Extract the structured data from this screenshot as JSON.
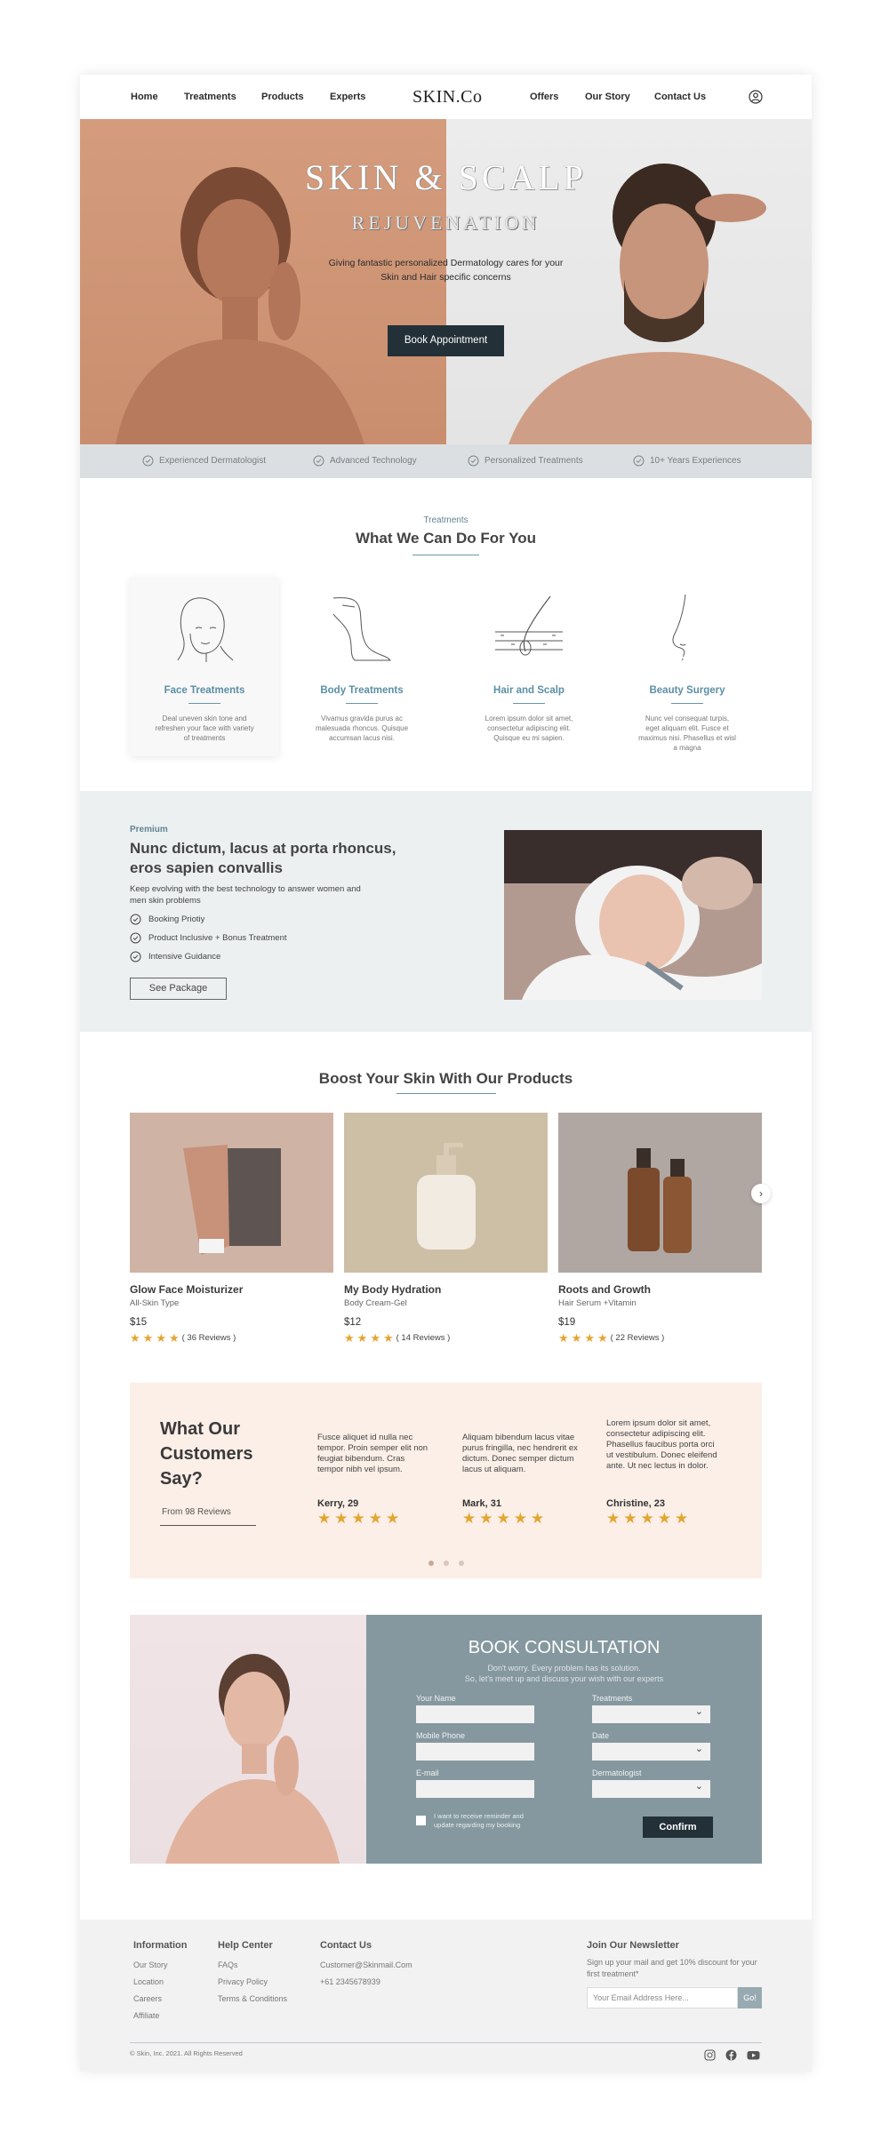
{
  "nav": {
    "home": "Home",
    "treatments": "Treatments",
    "products": "Products",
    "experts": "Experts",
    "logo": "SKIN.Co",
    "offers": "Offers",
    "our_story": "Our Story",
    "contact": "Contact Us",
    "user_icon": "user-circle-icon"
  },
  "hero": {
    "title": "SKIN & SCALP",
    "subtitle": "REJUVENATION",
    "description": "Giving fantastic personalized Dermatology cares for your Skin and Hair specific concerns",
    "button": "Book Appointment"
  },
  "features": [
    {
      "label": "Experienced Dermatologist",
      "icon": "check-circle-icon"
    },
    {
      "label": "Advanced Technology",
      "icon": "check-circle-icon"
    },
    {
      "label": "Personalized Treatments",
      "icon": "check-circle-icon"
    },
    {
      "label": "10+ Years Experiences",
      "icon": "check-circle-icon"
    }
  ],
  "treatments": {
    "eyebrow": "Treatments",
    "title": "What We Can Do For You",
    "items": [
      {
        "name": "Face Treatments",
        "desc": "Deal uneven skin tone and refreshen your face with variety of treatments",
        "icon": "face-icon"
      },
      {
        "name": "Body Treatments",
        "desc": "Vivamus gravida purus ac malesuada rhoncus. Quisque accumsan lacus nisi.",
        "icon": "leg-icon"
      },
      {
        "name": "Hair and Scalp",
        "desc": "Lorem ipsum dolor sit amet, consectetur adipiscing elit. Quisque eu mi sapien.",
        "icon": "hair-follicle-icon"
      },
      {
        "name": "Beauty Surgery",
        "desc": "Nunc vel consequat turpis, eget aliquam elit. Fusce et maximus nisi. Phasellus et wisl a magna",
        "icon": "nose-profile-icon"
      }
    ]
  },
  "premium": {
    "eyebrow": "Premium",
    "title": "Nunc dictum, lacus at porta rhoncus, eros sapien convallis",
    "description": "Keep evolving with the best technology to answer women and men skin problems",
    "items": [
      "Booking Priotiy",
      "Product Inclusive + Bonus Treatment",
      "Intensive Guidance"
    ],
    "button": "See Package"
  },
  "products": {
    "title": "Boost Your Skin With Our Products",
    "items": [
      {
        "name": "Glow Face Moisturizer",
        "type": "All-Skin Type",
        "price": "$15",
        "reviews": "( 36 Reviews )",
        "rating": 4
      },
      {
        "name": "My Body Hydration",
        "type": "Body Cream-Gel",
        "price": "$12",
        "reviews": "( 14  Reviews )",
        "rating": 4
      },
      {
        "name": "Roots and Growth",
        "type": "Hair Serum +Vitamin",
        "price": "$19",
        "reviews": "( 22  Reviews )",
        "rating": 4
      }
    ],
    "next_icon": "chevron-right-icon"
  },
  "testimonials": {
    "title": "What Our Customers Say?",
    "from": "From 98 Reviews",
    "items": [
      {
        "quote": "Fusce aliquet id nulla nec tempor. Proin semper elit non feugiat bibendum. Cras tempor nibh vel ipsum.",
        "name": "Kerry, 29",
        "rating": 5
      },
      {
        "quote": "Aliquam bibendum lacus vitae purus fringilla, nec hendrerit ex dictum. Donec semper dictum lacus ut aliquam.",
        "name": "Mark, 31",
        "rating": 5
      },
      {
        "quote": "Lorem ipsum dolor sit amet, consectetur adipiscing elit. Phasellus faucibus porta orci ut vestibulum. Donec eleifend ante. Ut nec lectus in dolor.",
        "name": "Christine, 23",
        "rating": 5
      }
    ],
    "active_slide": 1,
    "slide_count": 3
  },
  "consultation": {
    "title": "BOOK CONSULTATION",
    "subtitle_1": "Don't worry. Every problem has its solution.",
    "subtitle_2": "So, let's meet up and discuss your wish with our experts",
    "name_label": "Your Name",
    "phone_label": "Mobile Phone",
    "email_label": "E-mail",
    "treatments_label": "Treatments",
    "date_label": "Date",
    "derm_label": "Dermatologist",
    "checkbox_label": "I want to receive reminder and update regarding my booking",
    "button": "Confirm"
  },
  "footer": {
    "information": {
      "title": "Information",
      "links": [
        "Our Story",
        "Location",
        "Careers",
        "Affiliate"
      ]
    },
    "help": {
      "title": "Help Center",
      "links": [
        "FAQs",
        "Privacy Policy",
        "Terms & Conditions"
      ]
    },
    "contact": {
      "title": "Contact Us",
      "email": "Customer@Skinmail.Com",
      "phone": "+61 2345678939"
    },
    "newsletter": {
      "title": "Join Our Newsletter",
      "desc": "Sign up your mail and get 10% discount for your first treatment*",
      "placeholder": "Your Email Address Here...",
      "button": "Go!"
    },
    "copyright": "© Skin, Inc. 2021. All Rights Reserved",
    "social": [
      "instagram-icon",
      "facebook-icon",
      "youtube-icon"
    ]
  },
  "colors": {
    "accent": "#5f8591",
    "dark_button": "#233038",
    "star": "#e4a532",
    "hero_left": "#d49c7d",
    "consult_panel": "#86989f",
    "testimonial_bg": "#fbefe7"
  }
}
